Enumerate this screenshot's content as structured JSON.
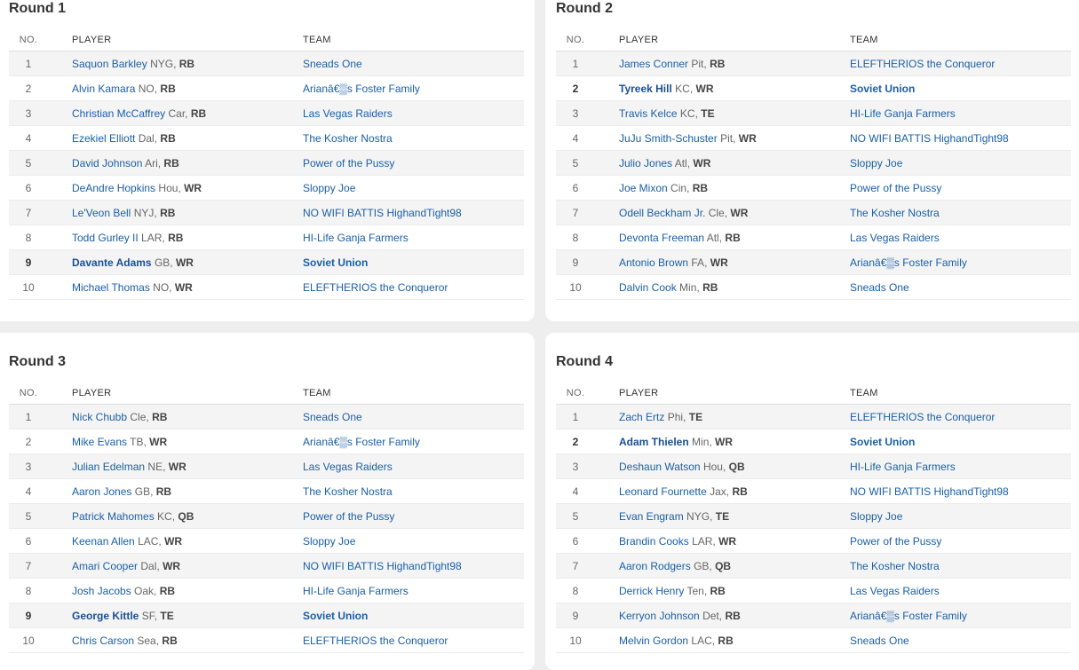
{
  "headers": {
    "no": "NO.",
    "player": "PLAYER",
    "team": "TEAM"
  },
  "rounds": [
    {
      "title": "Round 1",
      "picks": [
        {
          "no": "1",
          "player": "Saquon Barkley",
          "info": "NYG,",
          "pos": "RB",
          "team": "Sneads One",
          "mine": false
        },
        {
          "no": "2",
          "player": "Alvin Kamara",
          "info": "NO,",
          "pos": "RB",
          "team": "Arianâ€▒s Foster Family",
          "mine": false
        },
        {
          "no": "3",
          "player": "Christian McCaffrey",
          "info": "Car,",
          "pos": "RB",
          "team": "Las Vegas Raiders",
          "mine": false
        },
        {
          "no": "4",
          "player": "Ezekiel Elliott",
          "info": "Dal,",
          "pos": "RB",
          "team": "The Kosher Nostra",
          "mine": false
        },
        {
          "no": "5",
          "player": "David Johnson",
          "info": "Ari,",
          "pos": "RB",
          "team": "Power of the Pussy",
          "mine": false
        },
        {
          "no": "6",
          "player": "DeAndre Hopkins",
          "info": "Hou,",
          "pos": "WR",
          "team": "Sloppy Joe",
          "mine": false
        },
        {
          "no": "7",
          "player": "Le'Veon Bell",
          "info": "NYJ,",
          "pos": "RB",
          "team": "NO WIFI BATTIS HighandTight98",
          "mine": false
        },
        {
          "no": "8",
          "player": "Todd Gurley II",
          "info": "LAR,",
          "pos": "RB",
          "team": "HI-Life Ganja Farmers",
          "mine": false
        },
        {
          "no": "9",
          "player": "Davante Adams",
          "info": "GB,",
          "pos": "WR",
          "team": "Soviet Union",
          "mine": true
        },
        {
          "no": "10",
          "player": "Michael Thomas",
          "info": "NO,",
          "pos": "WR",
          "team": "ELEFTHERIOS the Conqueror",
          "mine": false
        }
      ]
    },
    {
      "title": "Round 2",
      "picks": [
        {
          "no": "1",
          "player": "James Conner",
          "info": "Pit,",
          "pos": "RB",
          "team": "ELEFTHERIOS the Conqueror",
          "mine": false
        },
        {
          "no": "2",
          "player": "Tyreek Hill",
          "info": "KC,",
          "pos": "WR",
          "team": "Soviet Union",
          "mine": true
        },
        {
          "no": "3",
          "player": "Travis Kelce",
          "info": "KC,",
          "pos": "TE",
          "team": "HI-Life Ganja Farmers",
          "mine": false
        },
        {
          "no": "4",
          "player": "JuJu Smith-Schuster",
          "info": "Pit,",
          "pos": "WR",
          "team": "NO WIFI BATTIS HighandTight98",
          "mine": false
        },
        {
          "no": "5",
          "player": "Julio Jones",
          "info": "Atl,",
          "pos": "WR",
          "team": "Sloppy Joe",
          "mine": false
        },
        {
          "no": "6",
          "player": "Joe Mixon",
          "info": "Cin,",
          "pos": "RB",
          "team": "Power of the Pussy",
          "mine": false
        },
        {
          "no": "7",
          "player": "Odell Beckham Jr.",
          "info": "Cle,",
          "pos": "WR",
          "team": "The Kosher Nostra",
          "mine": false
        },
        {
          "no": "8",
          "player": "Devonta Freeman",
          "info": "Atl,",
          "pos": "RB",
          "team": "Las Vegas Raiders",
          "mine": false
        },
        {
          "no": "9",
          "player": "Antonio Brown",
          "info": "FA,",
          "pos": "WR",
          "team": "Arianâ€▒s Foster Family",
          "mine": false
        },
        {
          "no": "10",
          "player": "Dalvin Cook",
          "info": "Min,",
          "pos": "RB",
          "team": "Sneads One",
          "mine": false
        }
      ]
    },
    {
      "title": "Round 3",
      "picks": [
        {
          "no": "1",
          "player": "Nick Chubb",
          "info": "Cle,",
          "pos": "RB",
          "team": "Sneads One",
          "mine": false
        },
        {
          "no": "2",
          "player": "Mike Evans",
          "info": "TB,",
          "pos": "WR",
          "team": "Arianâ€▒s Foster Family",
          "mine": false
        },
        {
          "no": "3",
          "player": "Julian Edelman",
          "info": "NE,",
          "pos": "WR",
          "team": "Las Vegas Raiders",
          "mine": false
        },
        {
          "no": "4",
          "player": "Aaron Jones",
          "info": "GB,",
          "pos": "RB",
          "team": "The Kosher Nostra",
          "mine": false
        },
        {
          "no": "5",
          "player": "Patrick Mahomes",
          "info": "KC,",
          "pos": "QB",
          "team": "Power of the Pussy",
          "mine": false
        },
        {
          "no": "6",
          "player": "Keenan Allen",
          "info": "LAC,",
          "pos": "WR",
          "team": "Sloppy Joe",
          "mine": false
        },
        {
          "no": "7",
          "player": "Amari Cooper",
          "info": "Dal,",
          "pos": "WR",
          "team": "NO WIFI BATTIS HighandTight98",
          "mine": false
        },
        {
          "no": "8",
          "player": "Josh Jacobs",
          "info": "Oak,",
          "pos": "RB",
          "team": "HI-Life Ganja Farmers",
          "mine": false
        },
        {
          "no": "9",
          "player": "George Kittle",
          "info": "SF,",
          "pos": "TE",
          "team": "Soviet Union",
          "mine": true
        },
        {
          "no": "10",
          "player": "Chris Carson",
          "info": "Sea,",
          "pos": "RB",
          "team": "ELEFTHERIOS the Conqueror",
          "mine": false
        }
      ]
    },
    {
      "title": "Round 4",
      "picks": [
        {
          "no": "1",
          "player": "Zach Ertz",
          "info": "Phi,",
          "pos": "TE",
          "team": "ELEFTHERIOS the Conqueror",
          "mine": false
        },
        {
          "no": "2",
          "player": "Adam Thielen",
          "info": "Min,",
          "pos": "WR",
          "team": "Soviet Union",
          "mine": true
        },
        {
          "no": "3",
          "player": "Deshaun Watson",
          "info": "Hou,",
          "pos": "QB",
          "team": "HI-Life Ganja Farmers",
          "mine": false
        },
        {
          "no": "4",
          "player": "Leonard Fournette",
          "info": "Jax,",
          "pos": "RB",
          "team": "NO WIFI BATTIS HighandTight98",
          "mine": false
        },
        {
          "no": "5",
          "player": "Evan Engram",
          "info": "NYG,",
          "pos": "TE",
          "team": "Sloppy Joe",
          "mine": false
        },
        {
          "no": "6",
          "player": "Brandin Cooks",
          "info": "LAR,",
          "pos": "WR",
          "team": "Power of the Pussy",
          "mine": false
        },
        {
          "no": "7",
          "player": "Aaron Rodgers",
          "info": "GB,",
          "pos": "QB",
          "team": "The Kosher Nostra",
          "mine": false
        },
        {
          "no": "8",
          "player": "Derrick Henry",
          "info": "Ten,",
          "pos": "RB",
          "team": "Las Vegas Raiders",
          "mine": false
        },
        {
          "no": "9",
          "player": "Kerryon Johnson",
          "info": "Det,",
          "pos": "RB",
          "team": "Arianâ€▒s Foster Family",
          "mine": false
        },
        {
          "no": "10",
          "player": "Melvin Gordon",
          "info": "LAC,",
          "pos": "RB",
          "team": "Sneads One",
          "mine": false
        }
      ]
    }
  ]
}
